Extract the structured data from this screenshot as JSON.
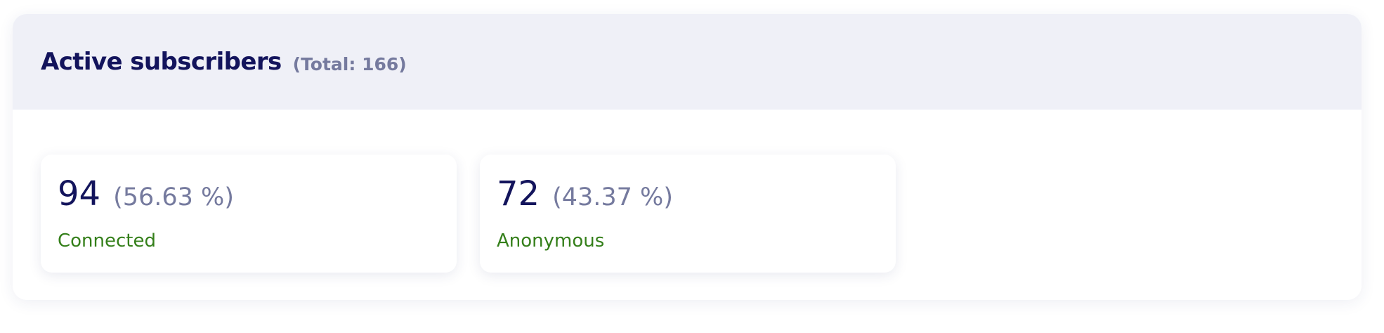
{
  "header": {
    "title": "Active subscribers",
    "total": "(Total: 166)"
  },
  "cards": [
    {
      "count": "94",
      "percent": "(56.63 %)",
      "label": "Connected"
    },
    {
      "count": "72",
      "percent": "(43.37 %)",
      "label": "Anonymous"
    }
  ],
  "colors": {
    "title": "#13145c",
    "muted": "#757a9e",
    "status_green": "#347f1a",
    "header_bg": "#eff0f7"
  }
}
